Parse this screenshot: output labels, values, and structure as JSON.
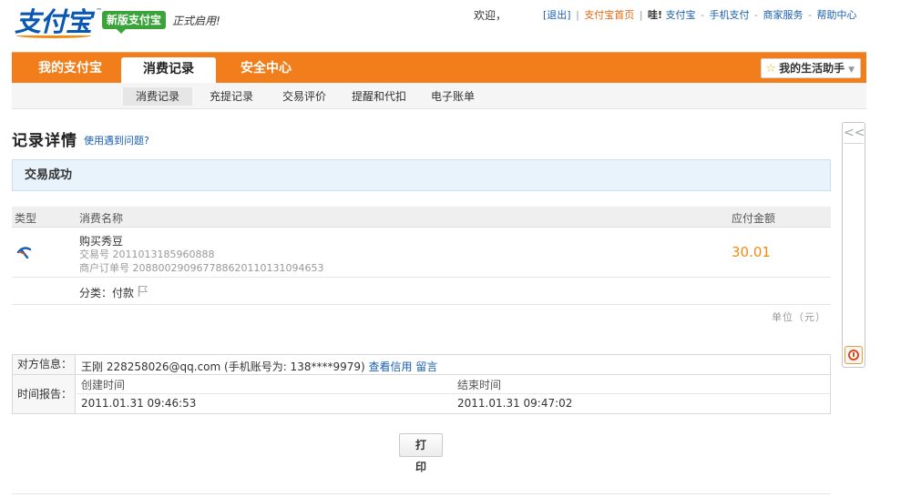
{
  "header": {
    "logo_text": "支付宝",
    "logo_tm": "™",
    "new_version_badge": "新版支付宝",
    "officially_launched": "正式启用!",
    "welcome": "欢迎，",
    "links": {
      "logout": "[退出]",
      "sep1": "|",
      "alipay_home": "支付宝首页",
      "sep2": "|",
      "wa_prefix": "哇!",
      "alipay": "支付宝",
      "dash1": "-",
      "mobile_pay": "手机支付",
      "dash2": "-",
      "merchant_service": "商家服务",
      "dash3": "-",
      "help_center": "帮助中心"
    }
  },
  "main_nav": {
    "tabs": [
      {
        "label": "我的支付宝"
      },
      {
        "label": "消费记录",
        "active": true
      },
      {
        "label": "安全中心"
      }
    ],
    "assistant": "我的生活助手"
  },
  "sub_nav": {
    "tabs": [
      {
        "label": "消费记录",
        "active": true
      },
      {
        "label": "充提记录"
      },
      {
        "label": "交易评价"
      },
      {
        "label": "提醒和代扣"
      },
      {
        "label": "电子账单"
      }
    ]
  },
  "page": {
    "title": "记录详情",
    "help_link": "使用遇到问题?",
    "status": "交易成功"
  },
  "table": {
    "headers": {
      "type": "类型",
      "name": "消费名称",
      "amount": "应付金额"
    },
    "item": {
      "name": "购买秀豆",
      "trade_no": "交易号 2011013185960888",
      "order_no": "商户订单号 20880029096778862011013109465​3",
      "amount": "30.01"
    },
    "category": "分类：付款",
    "unit": "单位（元）"
  },
  "info": {
    "counterparty_label": "对方信息：",
    "counterparty": "王刚 228258026@qq.com (手机账号为: 138****9979)",
    "check_credit": "查看信用",
    "leave_message": "留言",
    "time_label": "时间报告：",
    "created_label": "创建时间",
    "created_value": "2011.01.31 09:46:53",
    "ended_label": "结束时间",
    "ended_value": "2011.01.31 09:47:02"
  },
  "actions": {
    "print": "打 印"
  },
  "side_panel": {
    "collapse": "<<"
  },
  "colors": {
    "nav_orange": "#f27d1b",
    "brand_blue": "#0a58b4",
    "amount_orange": "#f28a12",
    "link_blue": "#1a5fb4"
  }
}
